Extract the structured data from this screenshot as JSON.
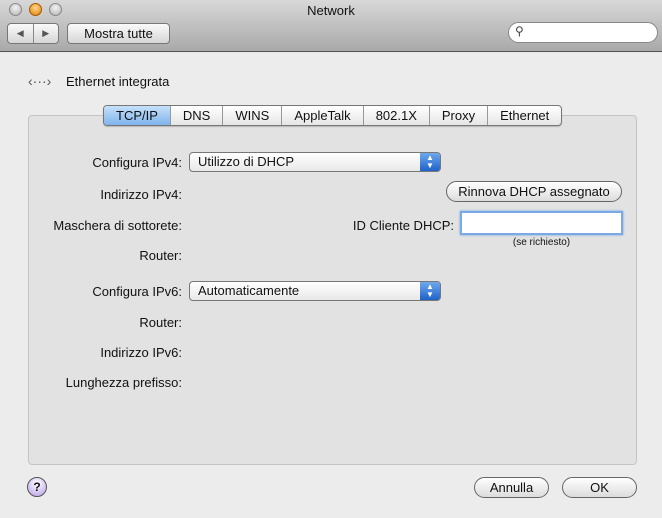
{
  "window": {
    "title": "Network"
  },
  "toolbar": {
    "back_icon": "◀",
    "forward_icon": "▶",
    "show_all": "Mostra tutte",
    "search_placeholder": ""
  },
  "service": {
    "name": "Ethernet integrata",
    "icon": "ethernet-icon"
  },
  "tabs": [
    {
      "label": "TCP/IP",
      "selected": true
    },
    {
      "label": "DNS"
    },
    {
      "label": "WINS"
    },
    {
      "label": "AppleTalk"
    },
    {
      "label": "802.1X"
    },
    {
      "label": "Proxy"
    },
    {
      "label": "Ethernet"
    }
  ],
  "form": {
    "configure_ipv4_label": "Configura IPv4:",
    "configure_ipv4_value": "Utilizzo di DHCP",
    "ipv4_address_label": "Indirizzo IPv4:",
    "subnet_mask_label": "Maschera di sottorete:",
    "router_label": "Router:",
    "renew_dhcp": "Rinnova DHCP assegnato",
    "dhcp_client_id_label": "ID Cliente DHCP:",
    "dhcp_client_id_value": "",
    "dhcp_client_id_hint": "(se richiesto)",
    "configure_ipv6_label": "Configura IPv6:",
    "configure_ipv6_value": "Automaticamente",
    "router6_label": "Router:",
    "ipv6_address_label": "Indirizzo IPv6:",
    "prefix_length_label": "Lunghezza prefisso:"
  },
  "footer": {
    "help": "?",
    "cancel": "Annulla",
    "ok": "OK"
  }
}
